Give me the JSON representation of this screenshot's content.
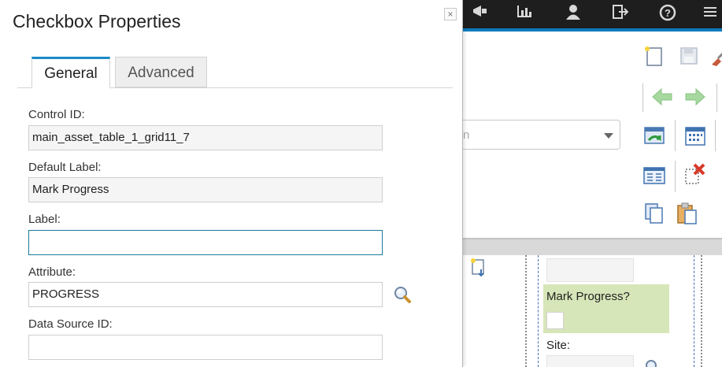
{
  "dialog": {
    "title": "Checkbox Properties",
    "close_glyph": "×",
    "tabs": [
      {
        "label": "General",
        "active": true
      },
      {
        "label": "Advanced",
        "active": false
      }
    ],
    "fields": {
      "control_id": {
        "label": "Control ID:",
        "value": "main_asset_table_1_grid11_7",
        "read_only": true
      },
      "default_label": {
        "label": "Default Label:",
        "value": "Mark Progress",
        "read_only": true
      },
      "label": {
        "label": "Label:",
        "value": "",
        "focused": true
      },
      "attribute": {
        "label": "Attribute:",
        "value": "PROGRESS"
      },
      "data_source_id": {
        "label": "Data Source ID:",
        "value": ""
      }
    },
    "accent_color": "#1a8ac8"
  },
  "app": {
    "topbar_icons": [
      "megaphone-icon",
      "bar-chart-icon",
      "user-icon",
      "sign-out-icon",
      "help-icon",
      "menu-icon"
    ],
    "toolbar_icons": [
      "new-record-icon",
      "save-icon",
      "clear-icon",
      "previous-icon",
      "next-icon",
      "refresh-icon",
      "calendar-icon",
      "form-icon",
      "delete-icon",
      "copy-icon",
      "paste-icon"
    ],
    "select_text": "n",
    "canvas": {
      "mark_progress_label": "Mark Progress?",
      "site_label": "Site:"
    }
  }
}
